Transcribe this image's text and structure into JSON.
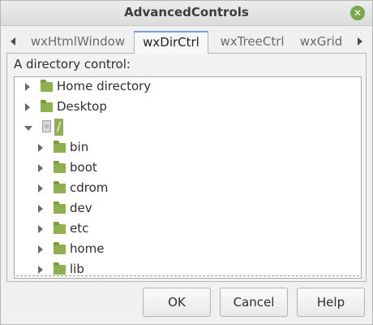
{
  "window": {
    "title": "AdvancedControls",
    "close_glyph": "✕"
  },
  "tabs": {
    "items": [
      {
        "label": "wxHtmlWindow",
        "selected": false
      },
      {
        "label": "wxDirCtrl",
        "selected": true
      },
      {
        "label": "wxTreeCtrl",
        "selected": false
      },
      {
        "label": "wxGrid",
        "selected": false
      }
    ],
    "scroll_left_icon": "triangle-left-icon",
    "scroll_right_icon": "triangle-right-icon"
  },
  "panel": {
    "label": "A directory control:"
  },
  "tree": {
    "items": [
      {
        "label": "Home directory",
        "depth": 0,
        "icon": "folder-icon",
        "expanded": false,
        "selected": false
      },
      {
        "label": "Desktop",
        "depth": 0,
        "icon": "folder-icon",
        "expanded": false,
        "selected": false
      },
      {
        "label": "/",
        "depth": 0,
        "icon": "drive-icon",
        "expanded": true,
        "selected": true
      },
      {
        "label": "bin",
        "depth": 1,
        "icon": "folder-icon",
        "expanded": false,
        "selected": false
      },
      {
        "label": "boot",
        "depth": 1,
        "icon": "folder-icon",
        "expanded": false,
        "selected": false
      },
      {
        "label": "cdrom",
        "depth": 1,
        "icon": "folder-icon",
        "expanded": false,
        "selected": false
      },
      {
        "label": "dev",
        "depth": 1,
        "icon": "folder-icon",
        "expanded": false,
        "selected": false
      },
      {
        "label": "etc",
        "depth": 1,
        "icon": "folder-icon",
        "expanded": false,
        "selected": false
      },
      {
        "label": "home",
        "depth": 1,
        "icon": "folder-icon",
        "expanded": false,
        "selected": false
      },
      {
        "label": "lib",
        "depth": 1,
        "icon": "folder-icon",
        "expanded": false,
        "selected": false
      }
    ]
  },
  "buttons": {
    "ok": "OK",
    "cancel": "Cancel",
    "help": "Help"
  },
  "colors": {
    "accent": "#8fb050",
    "selection_text": "#ffffff"
  }
}
